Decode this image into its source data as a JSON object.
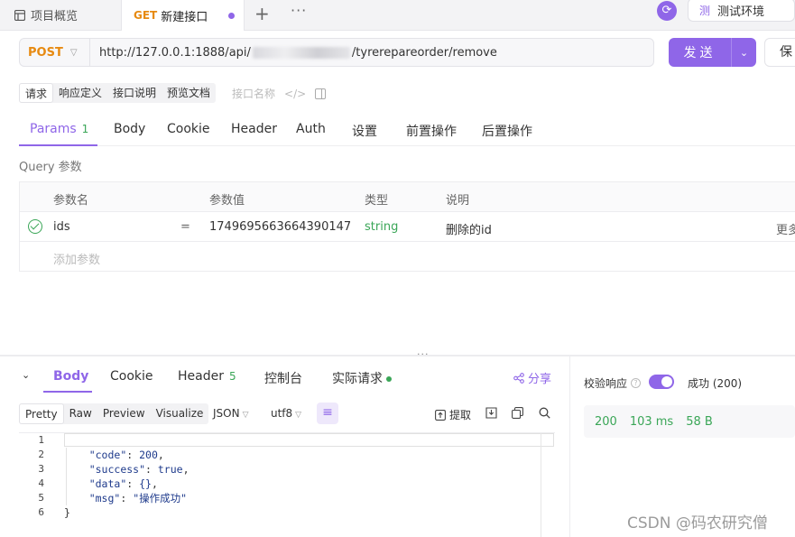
{
  "tabs": {
    "overview_label": "项目概览",
    "active_method": "GET",
    "active_label": "新建接口",
    "plus": "+",
    "more": "···"
  },
  "env": {
    "badge": "测",
    "name": "测试环境"
  },
  "request": {
    "method": "POST",
    "url_prefix": "http://127.0.0.1:1888/api/",
    "url_suffix": "/tyrerepareorder/remove",
    "send_label": "发送",
    "save_label": "保"
  },
  "subtabs": {
    "items": [
      "请求",
      "响应定义",
      "接口说明",
      "预览文档"
    ],
    "name_placeholder": "接口名称",
    "code_icon": "</>"
  },
  "param_tabs": {
    "items": [
      "Params",
      "Body",
      "Cookie",
      "Header",
      "Auth",
      "设置",
      "前置操作",
      "后置操作"
    ],
    "params_count": "1"
  },
  "query": {
    "section_label": "Query 参数",
    "headers": [
      "参数名",
      "参数值",
      "类型",
      "说明"
    ],
    "rows": [
      {
        "name": "ids",
        "op": "=",
        "value": "1749695663664390147",
        "type": "string",
        "desc": "删除的id",
        "more": "更多"
      }
    ],
    "add_placeholder": "添加参数"
  },
  "response": {
    "tabs": [
      "Body",
      "Cookie",
      "Header",
      "控制台",
      "实际请求"
    ],
    "header_count": "5",
    "share_label": "分享",
    "formats": [
      "Pretty",
      "Raw",
      "Preview",
      "Visualize"
    ],
    "content_type": "JSON",
    "encoding": "utf8",
    "extract_label": "提取",
    "line_numbers": [
      "1",
      "2",
      "3",
      "4",
      "5",
      "6"
    ],
    "code_lines": {
      "l1": "{",
      "l2_key": "\"code\"",
      "l2_val": "200",
      "l3_key": "\"success\"",
      "l3_val": "true",
      "l4_key": "\"data\"",
      "l4_val": "{}",
      "l5_key": "\"msg\"",
      "l5_val": "\"操作成功\"",
      "l6": "}"
    }
  },
  "validation": {
    "label": "校验响应",
    "status": "成功 (200)",
    "code": "200",
    "time": "103 ms",
    "size": "58 B"
  },
  "watermark": "CSDN @码农研究僧",
  "colors": {
    "accent": "#8f66e8",
    "method_post": "#e78a11",
    "success": "#3aa657"
  }
}
